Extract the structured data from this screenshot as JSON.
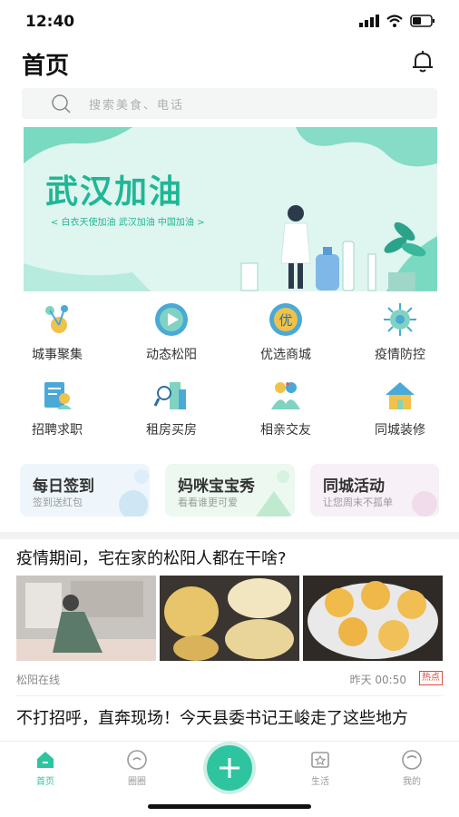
{
  "status": {
    "time": "12:40"
  },
  "header": {
    "title": "首页"
  },
  "search": {
    "placeholder": "搜索美食、电话"
  },
  "banner": {
    "title": "武汉加油",
    "subtitle": "< 白衣天使加油 武汉加油 中国加油 >"
  },
  "services": [
    {
      "label": "城事聚集",
      "icon": "city-news-icon"
    },
    {
      "label": "动态松阳",
      "icon": "play-icon"
    },
    {
      "label": "优选商城",
      "icon": "shop-icon"
    },
    {
      "label": "疫情防控",
      "icon": "virus-icon"
    },
    {
      "label": "招聘求职",
      "icon": "resume-icon"
    },
    {
      "label": "租房买房",
      "icon": "building-icon"
    },
    {
      "label": "相亲交友",
      "icon": "couple-icon"
    },
    {
      "label": "同城装修",
      "icon": "house-icon"
    }
  ],
  "cards": [
    {
      "title": "每日签到",
      "subtitle": "签到送红包"
    },
    {
      "title": "妈咪宝宝秀",
      "subtitle": "看看谁更可爱"
    },
    {
      "title": "同城活动",
      "subtitle": "让您周末不孤单"
    }
  ],
  "articles": [
    {
      "title": "疫情期间，宅在家的松阳人都在干啥?",
      "source": "松阳在线",
      "time": "昨天 00:50",
      "badge": "热点"
    },
    {
      "title": "不打招呼，直奔现场！今天县委书记王峻走了这些地方"
    }
  ],
  "tabbar": [
    {
      "label": "首页",
      "icon": "home-icon",
      "active": true
    },
    {
      "label": "圈圈",
      "icon": "circle-icon",
      "active": false
    },
    {
      "label": "生活",
      "icon": "life-icon",
      "active": false
    },
    {
      "label": "我的",
      "icon": "profile-icon",
      "active": false
    }
  ],
  "colors": {
    "accent": "#2ec4a0",
    "banner_text": "#1fb795",
    "hot": "#e04a3a"
  }
}
